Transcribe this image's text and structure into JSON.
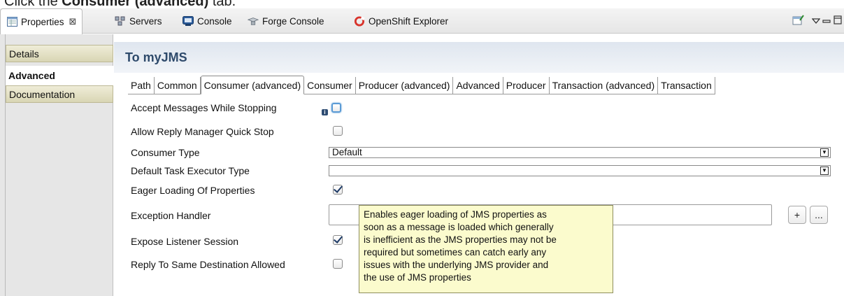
{
  "caption": {
    "prefix": "Click the ",
    "bold": "Consumer (advanced)",
    "suffix": " tab."
  },
  "view_tabs": [
    {
      "label": "Properties",
      "close": "⊠"
    },
    {
      "label": "Servers"
    },
    {
      "label": "Console"
    },
    {
      "label": "Forge Console"
    },
    {
      "label": "OpenShift Explorer"
    }
  ],
  "sidebar": {
    "items": [
      {
        "label": "Details"
      },
      {
        "label": "Advanced"
      },
      {
        "label": "Documentation"
      }
    ]
  },
  "header": {
    "title": "To myJMS"
  },
  "subtabs": [
    {
      "label": "Path"
    },
    {
      "label": "Common"
    },
    {
      "label": "Consumer (advanced)"
    },
    {
      "label": "Consumer"
    },
    {
      "label": "Producer (advanced)"
    },
    {
      "label": "Advanced"
    },
    {
      "label": "Producer"
    },
    {
      "label": "Transaction (advanced)"
    },
    {
      "label": "Transaction"
    }
  ],
  "fields": {
    "accept_messages": {
      "label": "Accept Messages While Stopping",
      "checked": false
    },
    "allow_reply": {
      "label": "Allow Reply Manager Quick Stop",
      "checked": false
    },
    "consumer_type": {
      "label": "Consumer Type",
      "value": "Default"
    },
    "default_task": {
      "label": "Default Task Executor Type",
      "value": ""
    },
    "eager_loading": {
      "label": "Eager Loading Of Properties",
      "checked": true
    },
    "exception_handler": {
      "label": "Exception Handler",
      "value": ""
    },
    "expose_listener": {
      "label": "Expose Listener Session",
      "checked": true
    },
    "reply_same": {
      "label": "Reply To Same Destination Allowed",
      "checked": false
    }
  },
  "buttons": {
    "add": "+",
    "browse": "..."
  },
  "tooltip": {
    "lines": [
      "Enables eager loading of JMS properties as",
      "soon as a message is loaded which generally",
      "is inefficient as the JMS properties may not be",
      "required but sometimes can catch early any",
      "issues with the underlying JMS provider and",
      "the use of JMS properties"
    ]
  },
  "info_badge": "i",
  "icons": [
    "properties-icon",
    "servers-icon",
    "console-icon",
    "forge-console-icon",
    "openshift-icon",
    "new-view-icon",
    "view-menu-icon",
    "minimize-icon",
    "maximize-icon",
    "info-icon"
  ],
  "colors": {
    "header_title": "#2e4a6b",
    "tooltip_bg": "#fbfbcd",
    "openshift_red": "#d8332b",
    "focus_blue": "#5b9bd5"
  }
}
